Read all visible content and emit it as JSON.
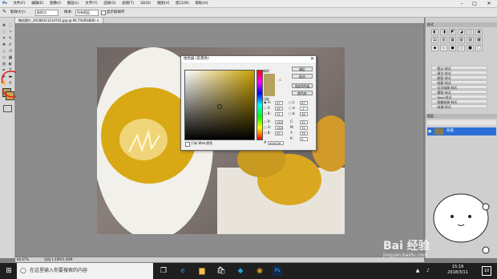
{
  "menubar": {
    "items": [
      "文件(F)",
      "编辑(E)",
      "图像(I)",
      "图层(L)",
      "文字(Y)",
      "选择(S)",
      "滤镜(T)",
      "3D(D)",
      "视图(V)",
      "窗口(W)",
      "帮助(H)"
    ],
    "window_controls": [
      "–",
      "□",
      "✕"
    ]
  },
  "options": {
    "tool_label": "取样大小:",
    "sample_value": "取样点",
    "sample_label": "样本:",
    "sample_layer": "所有图层",
    "checkbox_label": "显示取样环"
  },
  "document": {
    "tab_label": "微信图片_20180311214741.jpg @ 66.7%(RGB/8) ×",
    "status_zoom": "66.67%",
    "status_doc": "文档:1.40M/1.40M"
  },
  "picker": {
    "title": "拾色器 (前景色)",
    "close": "✕",
    "new_label": "新的",
    "current_label": "当前",
    "buttons": [
      "确定",
      "取消",
      "添加到色板",
      "颜色库"
    ],
    "web_only": "只有 Web 颜色",
    "fields": {
      "H": "47",
      "S": "49",
      "B": "71",
      "R": "181",
      "G": "162",
      "Bl": "93",
      "L": "67",
      "a": "-2",
      "b": "36",
      "C": "32",
      "M": "35",
      "Y": "76",
      "K": "0"
    },
    "hex": "b5a25d",
    "color_new": "#b5a25d",
    "color_current": "#b5a25d"
  },
  "dock": {
    "styles_header": "样式",
    "styles": [
      "\"默认\"样式",
      "\"原生\"样式",
      "\"颜色\"样式",
      "\"投影\"样式",
      "\"文字效果\"样式",
      "\"蒙版\"样式",
      "\"Web\"样式",
      "\"图像效果\"样式",
      "\"纹理\"样式"
    ],
    "layers_header": "图层",
    "layer_name": "背景"
  },
  "taskbar": {
    "search_placeholder": "在这里输入你要搜索的内容",
    "time": "15:19",
    "date": "2018/3/11",
    "notify": "10"
  },
  "watermark": {
    "brand": "Bai 经验",
    "url": "jingyan.baidu.com"
  },
  "colors": {
    "foreground": "#b5a25d",
    "accent_annotation": "#e02020",
    "active_layer": "#2a6fd6"
  }
}
